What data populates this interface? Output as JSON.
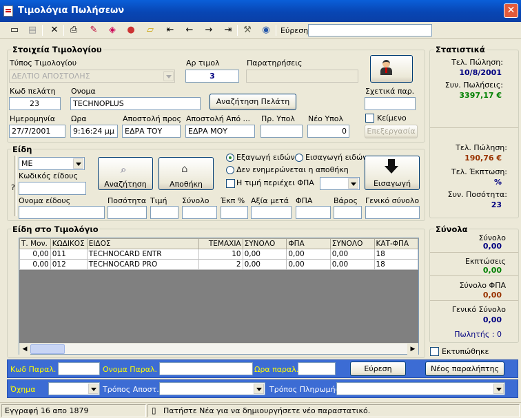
{
  "window": {
    "title": "Τιμολόγια Πωλήσεων",
    "close": "✕"
  },
  "toolbar": {
    "search_label": "Εύρεση",
    "search_value": "",
    "icons": [
      "new-doc-icon",
      "save-icon",
      "delete-icon",
      "print-icon",
      "edit-icon",
      "palette-icon",
      "user-icon",
      "open-folder-icon",
      "first-icon",
      "prev-icon",
      "next-icon",
      "last-icon",
      "tools-icon",
      "refresh-icon"
    ]
  },
  "invoice": {
    "group_title": "Στοιχεία Τιμολογίου",
    "type_label": "Τύπος Τιμολογίου",
    "type_value": "ΔΕΛΤΙΟ ΑΠΟΣΤΟΛΗΣ",
    "num_label": "Αρ τιμολ",
    "num_value": "3",
    "notes_label": "Παρατηρήσεις",
    "notes_value": "",
    "code_label": "Κωδ πελάτη",
    "code_value": "23",
    "name_label": "Ονομα",
    "name_value": "TECHNOPLUS",
    "search_customer": "Αναζήτηση Πελάτη",
    "related_label": "Σχετικά παρ.",
    "related_value": "",
    "date_label": "Ημερομηνία",
    "date_value": "27/7/2001",
    "time_label": "Ωρα",
    "time_value": "9:16:24 μμ",
    "ship_to_label": "Αποστολή προς",
    "ship_to_value": "ΕΔΡΑ ΤΟΥ",
    "ship_from_label": "Αποστολή Από ...",
    "ship_from_value": "ΕΔΡΑ ΜΟΥ",
    "prev_bal_label": "Πρ. Υπολ",
    "prev_bal_value": "",
    "new_bal_label": "Νέο Υπολ",
    "new_bal_value": "0",
    "text_label": "Κείμενο",
    "edit_btn": "Επεξεργασία"
  },
  "items": {
    "group_title": "Είδη",
    "unit_value": "ME",
    "code_label": "Κωδικός είδους",
    "code_value": "",
    "question": "?",
    "search_btn": "Αναζήτηση",
    "warehouse_btn": "Αποθήκη",
    "radio_export": "Εξαγωγή ειδών",
    "radio_import": "Εισαγωγή ειδών",
    "radio_nostock": "Δεν ενημερώνεται η αποθήκη",
    "chk_vat": "Η τιμή περιέχει ΦΠΑ",
    "vat_select": "",
    "insert_btn": "Εισαγωγή",
    "cols": [
      "Ονομα είδους",
      "Ποσότητα",
      "Τιμή",
      "Σύνολο",
      "Έκπ %",
      "Αξία μετά",
      "ΦΠΑ",
      "Βάρος",
      "Γενικό σύνολο"
    ]
  },
  "lines": {
    "group_title": "Είδη στο Τιμολόγιο",
    "headers": [
      "Τ. Μον.",
      "ΚΩΔΙΚΟΣ",
      "ΕΙΔΟΣ",
      "ΤΕΜΑΧΙΑ",
      "ΣΥΝΟΛΟ",
      "ΦΠΑ",
      "ΣΥΝΟΛΟ",
      "ΚΑΤ-ΦΠΑ"
    ],
    "rows": [
      [
        "0,00",
        "011",
        "TECHNOCARD ENTR",
        "10",
        "0,00",
        "0,00",
        "0,00",
        "18"
      ],
      [
        "0,00",
        "012",
        "TECHNOCARD PRO",
        "2",
        "0,00",
        "0,00",
        "0,00",
        "18"
      ]
    ]
  },
  "stats": {
    "group_title": "Στατιστικά",
    "last_sale_label": "Τελ. Πώληση:",
    "last_sale_value": "10/8/2001",
    "total_sales_label": "Συν. Πωλήσεις:",
    "total_sales_value": "3397,17 €",
    "last_sale2_label": "Τελ. Πώληση:",
    "last_sale2_value": "190,76 €",
    "last_disc_label": "Τελ. Έκπτωση:",
    "last_disc_value": "%",
    "total_qty_label": "Συν. Ποσότητα:",
    "total_qty_value": "23"
  },
  "totals": {
    "group_title": "Σύνολα",
    "sum_label": "Σύνολο",
    "sum_value": "0,00",
    "disc_label": "Εκπτώσεις",
    "disc_value": "0,00",
    "vat_label": "Σύνολο ΦΠΑ",
    "vat_value": "0,00",
    "grand_label": "Γενικό Σύνολο",
    "grand_value": "0,00",
    "seller": "Πωλητής : 0",
    "printed_label": "Εκτυπώθηκε"
  },
  "receipt_bar": {
    "code_label": "Κωδ Παραλ.",
    "code_value": "",
    "name_label": "Ονομα Παραλ.",
    "name_value": "",
    "time_label": "Ωρα παραλ.",
    "time_value": "",
    "find_btn": "Εύρεση",
    "new_btn": "Νέος παραλήπτης"
  },
  "ship_bar": {
    "vehicle_label": "Όχημα",
    "vehicle_value": "",
    "method_label": "Τρόπος Αποστ.",
    "method_value": "",
    "payment_label": "Τρόπος Πληρωμής",
    "payment_value": ""
  },
  "status": {
    "record": "Εγγραφή 16 απο 1879",
    "hint": "Πατήστε Νέα για να δημιουργήσετε νέο παραστατικό."
  }
}
